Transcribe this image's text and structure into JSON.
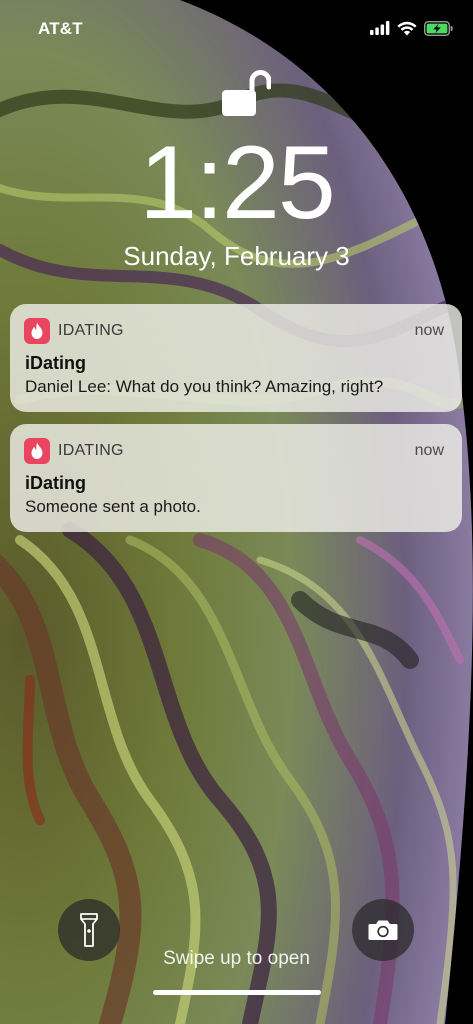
{
  "status_bar": {
    "carrier": "AT&T",
    "signal_icon": "cellular-signal-icon",
    "wifi_icon": "wifi-icon",
    "battery_icon": "battery-charging-icon",
    "battery_color": "#4cd964"
  },
  "lock_screen": {
    "lock_icon": "unlocked-padlock-icon",
    "time": "1:25",
    "date": "Sunday, February 3"
  },
  "notifications": [
    {
      "app_icon": "flame-icon",
      "app_name": "IDATING",
      "time": "now",
      "title": "iDating",
      "body": "Daniel Lee: What do you think? Amazing, right?"
    },
    {
      "app_icon": "flame-icon",
      "app_name": "IDATING",
      "time": "now",
      "title": "iDating",
      "body": "Someone sent a photo."
    }
  ],
  "bottom": {
    "flashlight_icon": "flashlight-icon",
    "camera_icon": "camera-icon",
    "swipe_hint": "Swipe up to open"
  },
  "colors": {
    "app_icon_bg": "#e94560",
    "notification_bg": "#eeeee8"
  }
}
